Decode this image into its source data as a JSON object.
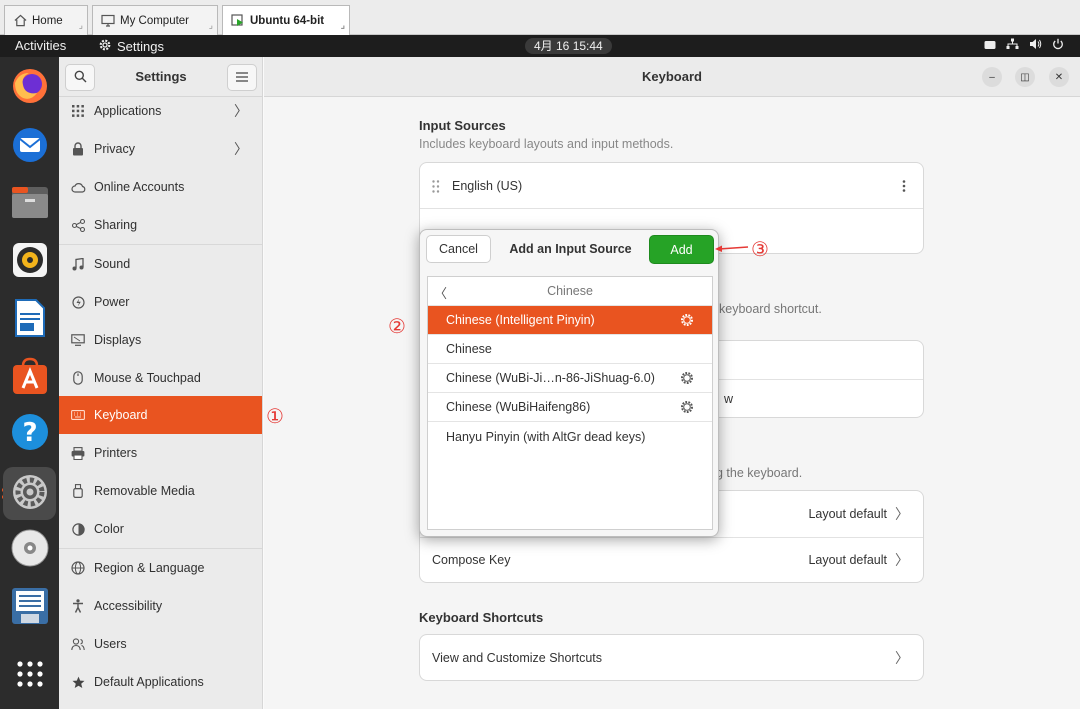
{
  "vm_tabs": [
    {
      "label": "Home",
      "icon": "home-icon"
    },
    {
      "label": "My Computer",
      "icon": "monitor-icon"
    },
    {
      "label": "Ubuntu 64-bit",
      "icon": "vm-play-icon",
      "active": true
    }
  ],
  "topbar": {
    "activities": "Activities",
    "app_name": "Settings",
    "clock": "4月 16  15:44"
  },
  "settings_header": {
    "title": "Settings"
  },
  "sidebar": {
    "items": [
      {
        "label": "Applications",
        "icon": "apps-grid-icon",
        "chevron": true
      },
      {
        "label": "Privacy",
        "icon": "lock-icon",
        "chevron": true
      },
      {
        "label": "Online Accounts",
        "icon": "cloud-icon"
      },
      {
        "label": "Sharing",
        "icon": "share-icon"
      },
      {
        "label": "Sound",
        "icon": "music-note-icon"
      },
      {
        "label": "Power",
        "icon": "power-icon"
      },
      {
        "label": "Displays",
        "icon": "display-icon"
      },
      {
        "label": "Mouse & Touchpad",
        "icon": "mouse-icon"
      },
      {
        "label": "Keyboard",
        "icon": "keyboard-icon",
        "selected": true
      },
      {
        "label": "Printers",
        "icon": "printer-icon"
      },
      {
        "label": "Removable Media",
        "icon": "usb-icon"
      },
      {
        "label": "Color",
        "icon": "color-icon"
      },
      {
        "label": "Region & Language",
        "icon": "globe-icon"
      },
      {
        "label": "Accessibility",
        "icon": "accessibility-icon"
      },
      {
        "label": "Users",
        "icon": "users-icon"
      },
      {
        "label": "Default Applications",
        "icon": "star-icon"
      }
    ]
  },
  "main_header": {
    "title": "Keyboard"
  },
  "input_sources": {
    "title": "Input Sources",
    "subtitle": "Includes keyboard layouts and input methods.",
    "first_source": "English (US)"
  },
  "partial_text": {
    "shortcut_fragment": "keyboard shortcut.",
    "view_fragment": "w",
    "keyboard_fragment": "g the keyboard."
  },
  "special_keys": {
    "row1_value": "Layout default",
    "compose_label": "Compose Key",
    "compose_value": "Layout default"
  },
  "keyboard_shortcuts": {
    "title": "Keyboard Shortcuts",
    "row_label": "View and Customize Shortcuts"
  },
  "dialog": {
    "cancel": "Cancel",
    "title": "Add an Input Source",
    "add": "Add",
    "list_header": "Chinese",
    "items": [
      {
        "label": "Chinese (Intelligent Pinyin)",
        "gear": true,
        "selected": true
      },
      {
        "label": "Chinese",
        "gear": false
      },
      {
        "label": "Chinese (WuBi-Ji…n-86-JiShuag-6.0)",
        "gear": true
      },
      {
        "label": "Chinese (WuBiHaifeng86)",
        "gear": true
      },
      {
        "label": "Hanyu Pinyin (with AltGr dead keys)",
        "gear": false
      }
    ]
  },
  "annotations": {
    "one": "①",
    "two": "②",
    "three": "③"
  },
  "colors": {
    "accent": "#e95420",
    "add_button": "#26a326",
    "annotation": "#e53935"
  }
}
